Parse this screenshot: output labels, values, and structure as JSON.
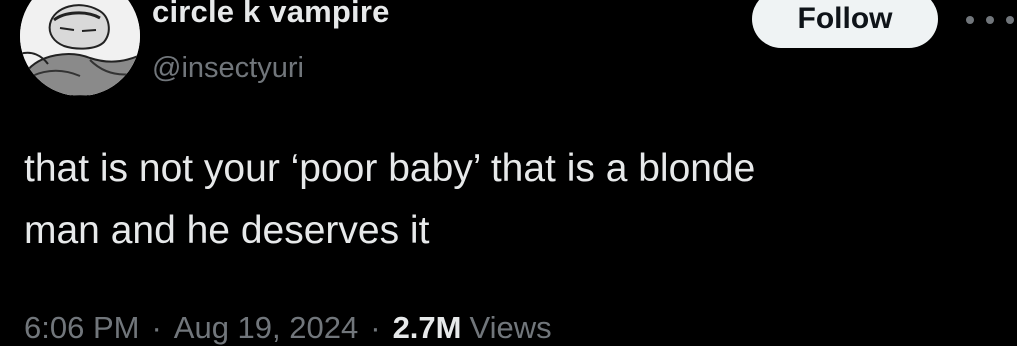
{
  "user": {
    "display_name": "circle k vampire",
    "handle": "@insectyuri"
  },
  "actions": {
    "follow_label": "Follow",
    "more_icon": "more-horizontal-icon"
  },
  "tweet": {
    "text": "that is not your ‘poor baby’ that is a blonde\nman and he deserves it"
  },
  "meta": {
    "time": "6:06 PM",
    "separator": "·",
    "date": "Aug 19, 2024",
    "views_count": "2.7M",
    "views_label": "Views"
  },
  "colors": {
    "background": "#000000",
    "primary_text": "#e7e9ea",
    "secondary_text": "#71767b",
    "follow_button_bg": "#eff3f4",
    "follow_button_text": "#0f1419"
  }
}
